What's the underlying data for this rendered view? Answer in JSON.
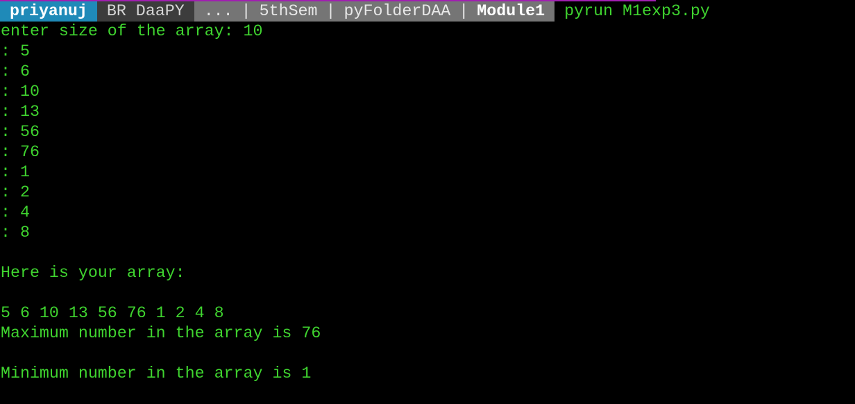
{
  "prompt": {
    "user": "priyanuj",
    "env": "BR DaaPY",
    "path": [
      {
        "label": "...",
        "current": false
      },
      {
        "label": "5thSem",
        "current": false
      },
      {
        "label": "pyFolderDAA",
        "current": false
      },
      {
        "label": "Module1",
        "current": true
      }
    ],
    "separator": "|",
    "command": "pyrun M1exp3.py"
  },
  "output": [
    "enter size of the array: 10",
    ": 5",
    ": 6",
    ": 10",
    ": 13",
    ": 56",
    ": 76",
    ": 1",
    ": 2",
    ": 4",
    ": 8",
    "",
    "Here is your array:",
    "",
    "5 6 10 13 56 76 1 2 4 8",
    "Maximum number in the array is 76",
    "",
    "Minimum number in the array is 1"
  ],
  "colors": {
    "background": "#000000",
    "terminal_text": "#3fd32f",
    "user_segment": "#1f8ab8",
    "env_segment": "#3c3c3c",
    "path_segment": "#757575",
    "accent_line": "#a01fb0"
  }
}
